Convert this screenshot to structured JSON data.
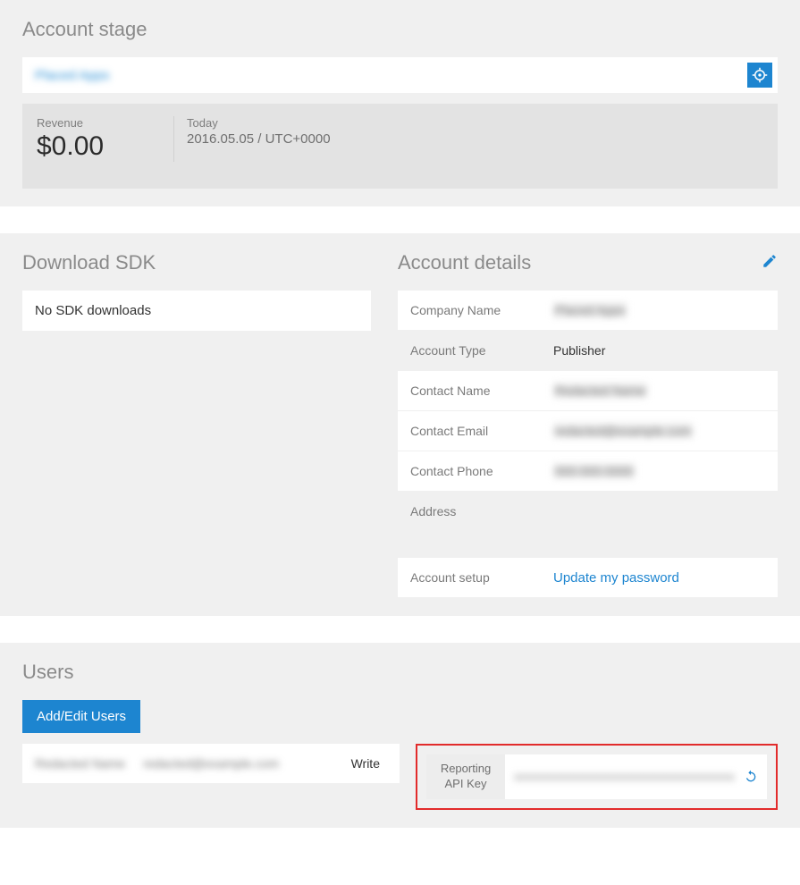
{
  "account_stage": {
    "title": "Account stage",
    "app_name": "Placed Apps",
    "revenue_label": "Revenue",
    "revenue_value": "$0.00",
    "today_label": "Today",
    "today_value": "2016.05.05 / UTC+0000"
  },
  "sdk": {
    "title": "Download SDK",
    "empty_text": "No SDK downloads"
  },
  "account_details": {
    "title": "Account details",
    "rows": {
      "company_name_label": "Company Name",
      "company_name_value": "Placed Apps",
      "account_type_label": "Account Type",
      "account_type_value": "Publisher",
      "contact_name_label": "Contact Name",
      "contact_name_value": "Redacted Name",
      "contact_email_label": "Contact Email",
      "contact_email_value": "redacted@example.com",
      "contact_phone_label": "Contact Phone",
      "contact_phone_value": "000-000-0000",
      "address_label": "Address",
      "account_setup_label": "Account setup",
      "update_password_link": "Update my password"
    }
  },
  "users": {
    "title": "Users",
    "add_edit_button": "Add/Edit Users",
    "row": {
      "name": "Redacted Name",
      "email": "redacted@example.com",
      "permission": "Write"
    },
    "api": {
      "label": "Reporting API Key",
      "value": "xxxxxxxxxxxxxxxxxxxxxxxxxxxxxxxxxxxxxx"
    }
  }
}
